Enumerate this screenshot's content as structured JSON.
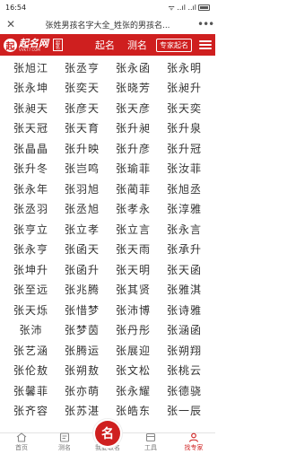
{
  "status": {
    "time": "16:54",
    "network": "ᯤ ..ıl ..ıl",
    "battery": ""
  },
  "browser": {
    "close_glyph": "✕",
    "title": "张姓男孩名字大全_姓张的男孩名...",
    "more_glyph": "•••"
  },
  "header": {
    "logo_mark": "起",
    "logo_cn": "起名网",
    "logo_en": "VVK77.COM",
    "seal_text": "起名",
    "nav": [
      {
        "label": "起名"
      },
      {
        "label": "测名"
      }
    ],
    "pro_label": "专家起名"
  },
  "names": [
    "张旭江",
    "张丞亨",
    "张永函",
    "张永明",
    "张永坤",
    "张奕天",
    "张晓芳",
    "张昶升",
    "张昶天",
    "张彦天",
    "张天彦",
    "张天奕",
    "张天冠",
    "张天育",
    "张升昶",
    "张升泉",
    "张晶晶",
    "张升映",
    "张升彦",
    "张升冠",
    "张升冬",
    "张岂鸣",
    "张瑜菲",
    "张汝菲",
    "张永年",
    "张羽旭",
    "张蔺菲",
    "张旭丞",
    "张丞羽",
    "张丞旭",
    "张孝永",
    "张淳雅",
    "张亨立",
    "张立孝",
    "张立言",
    "张永言",
    "张永亨",
    "张函天",
    "张天雨",
    "张承升",
    "张坤升",
    "张函升",
    "张天明",
    "张天函",
    "张至远",
    "张兆腾",
    "张其贤",
    "张雅淇",
    "张天烁",
    "张惜梦",
    "张沛博",
    "张诗雅",
    "张沛",
    "张梦茵",
    "张丹彤",
    "张涵函",
    "张艺涵",
    "张腾运",
    "张展迎",
    "张朔翔",
    "张伦敖",
    "张朔敖",
    "张文松",
    "张桃云",
    "张馨菲",
    "张亦萌",
    "张永耀",
    "张德骁",
    "张齐容",
    "张苏湛",
    "张皓东",
    "张一辰"
  ],
  "bottom_nav": [
    {
      "label": "首页",
      "icon": "home-icon"
    },
    {
      "label": "测名",
      "icon": "test-icon"
    },
    {
      "label": "我要取名",
      "icon": "naming-center-icon"
    },
    {
      "label": "工具",
      "icon": "tools-icon"
    },
    {
      "label": "找专家",
      "icon": "expert-icon"
    }
  ],
  "center_glyph": "名",
  "colors": {
    "brand_red": "#cf1f1f",
    "text": "#333333"
  }
}
